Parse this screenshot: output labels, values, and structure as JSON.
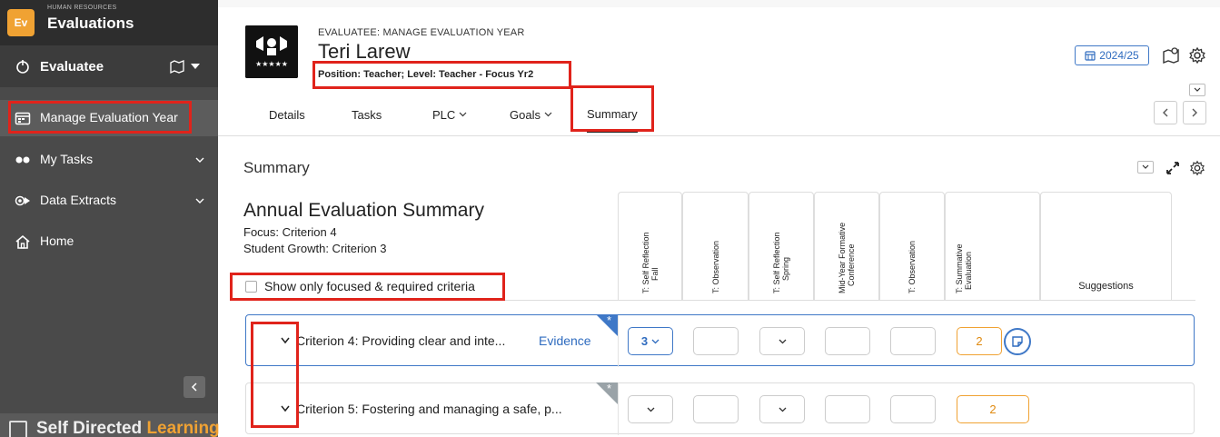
{
  "sidebar": {
    "logo_text": "Ev",
    "app_subtitle": "HUMAN RESOURCES",
    "app_title": "Evaluations",
    "role_label": "Evaluatee",
    "items": [
      {
        "label": "Manage Evaluation Year",
        "icon": "calendar-icon"
      },
      {
        "label": "My Tasks",
        "icon": "tasks-icon"
      },
      {
        "label": "Data Extracts",
        "icon": "extract-icon"
      },
      {
        "label": "Home",
        "icon": "home-icon"
      }
    ],
    "bottom_brand_a": "Self Directed ",
    "bottom_brand_b": "Learning"
  },
  "header": {
    "breadcrumb": "EVALUATEE: MANAGE EVALUATION YEAR",
    "employee_name": "Teri Larew",
    "position": "Position: Teacher; Level: Teacher - Focus Yr2",
    "year": "2024/25",
    "tabs": [
      {
        "label": "Details"
      },
      {
        "label": "Tasks"
      },
      {
        "label": "PLC"
      },
      {
        "label": "Goals"
      },
      {
        "label": "Summary"
      }
    ]
  },
  "summary": {
    "section_title": "Summary",
    "annual_title": "Annual Evaluation Summary",
    "focus": "Focus: Criterion 4",
    "growth": "Student Growth: Criterion 3",
    "filter_label": "Show only focused & required criteria",
    "columns": [
      {
        "line1": "T: Self Reflection",
        "line2": "Fall"
      },
      {
        "line1": "T: Observation",
        "line2": ""
      },
      {
        "line1": "T: Self Reflection",
        "line2": "Spring"
      },
      {
        "line1": "Mid-Year Formative",
        "line2": "Conference"
      },
      {
        "line1": "T: Observation",
        "line2": ""
      },
      {
        "line1": "T: Summative",
        "line2": "Evaluation"
      }
    ],
    "suggestions_label": "Suggestions",
    "rows": [
      {
        "criterion": "Criterion 4: Providing clear and inte...",
        "evidence": "Evidence",
        "self_fall": "3",
        "summative": "2"
      },
      {
        "criterion": "Criterion 5: Fostering and managing a safe, p...",
        "evidence": "",
        "self_fall": "",
        "summative": "2"
      }
    ]
  },
  "colors": {
    "accent": "#3f78c7",
    "orange": "#f0a233",
    "annotation_red": "#e0231b",
    "sidebar": "#4a4a4a"
  }
}
